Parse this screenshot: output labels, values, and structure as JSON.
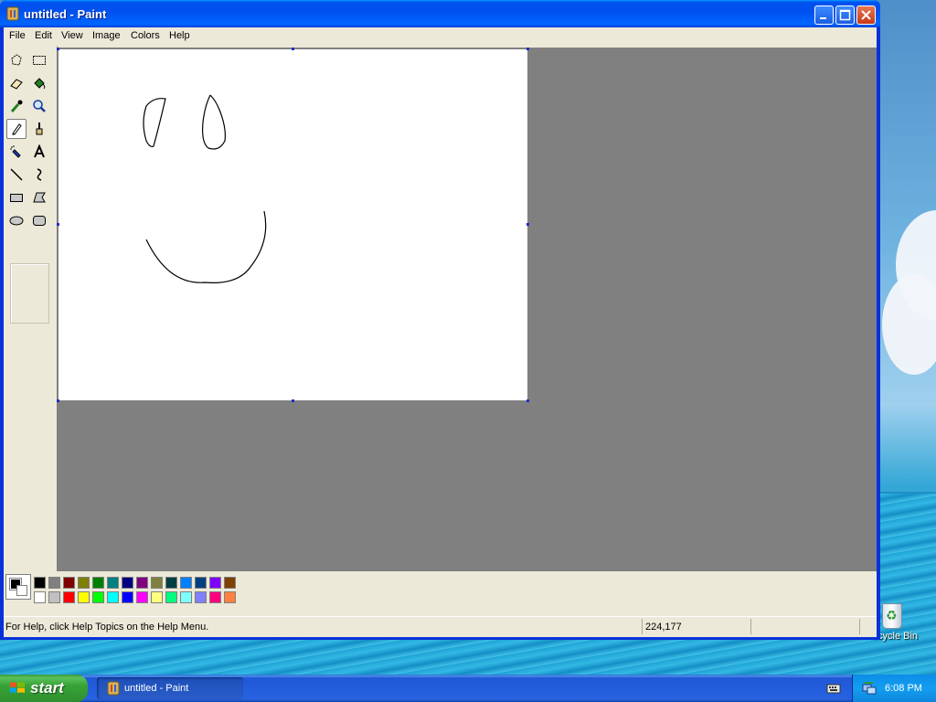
{
  "window": {
    "title": "untitled - Paint"
  },
  "menu": {
    "items": [
      "File",
      "Edit",
      "View",
      "Image",
      "Colors",
      "Help"
    ]
  },
  "tools": [
    {
      "name": "free-form-select",
      "icon": "free-form-select-icon"
    },
    {
      "name": "select",
      "icon": "rect-select-icon"
    },
    {
      "name": "eraser",
      "icon": "eraser-icon"
    },
    {
      "name": "fill-with-color",
      "icon": "paint-bucket-icon"
    },
    {
      "name": "pick-color",
      "icon": "eyedropper-icon"
    },
    {
      "name": "magnifier",
      "icon": "magnifier-icon"
    },
    {
      "name": "pencil",
      "icon": "pencil-icon",
      "selected": true
    },
    {
      "name": "brush",
      "icon": "brush-icon"
    },
    {
      "name": "airbrush",
      "icon": "airbrush-icon"
    },
    {
      "name": "text",
      "icon": "text-icon"
    },
    {
      "name": "line",
      "icon": "line-icon"
    },
    {
      "name": "curve",
      "icon": "curve-icon"
    },
    {
      "name": "rectangle",
      "icon": "rectangle-icon"
    },
    {
      "name": "polygon",
      "icon": "polygon-icon"
    },
    {
      "name": "ellipse",
      "icon": "ellipse-icon"
    },
    {
      "name": "rounded-rectangle",
      "icon": "rounded-rectangle-icon"
    }
  ],
  "palette": {
    "foreground": "#000000",
    "background": "#ffffff",
    "top_row": [
      "#000000",
      "#808080",
      "#800000",
      "#808000",
      "#008000",
      "#008080",
      "#000080",
      "#800080",
      "#808040",
      "#004040",
      "#0080ff",
      "#004080",
      "#8000ff",
      "#804000"
    ],
    "bottom_row": [
      "#ffffff",
      "#c0c0c0",
      "#ff0000",
      "#ffff00",
      "#00ff00",
      "#00ffff",
      "#0000ff",
      "#ff00ff",
      "#ffff80",
      "#00ff80",
      "#80ffff",
      "#8080ff",
      "#ff0080",
      "#ff8040"
    ]
  },
  "status": {
    "help_text": "For Help, click Help Topics on the Help Menu.",
    "coords": "224,177"
  },
  "desktop": {
    "recycle_bin_label": "Recycle Bin"
  },
  "taskbar": {
    "start_label": "start",
    "task_label": "untitled - Paint",
    "clock": "6:08 PM"
  }
}
